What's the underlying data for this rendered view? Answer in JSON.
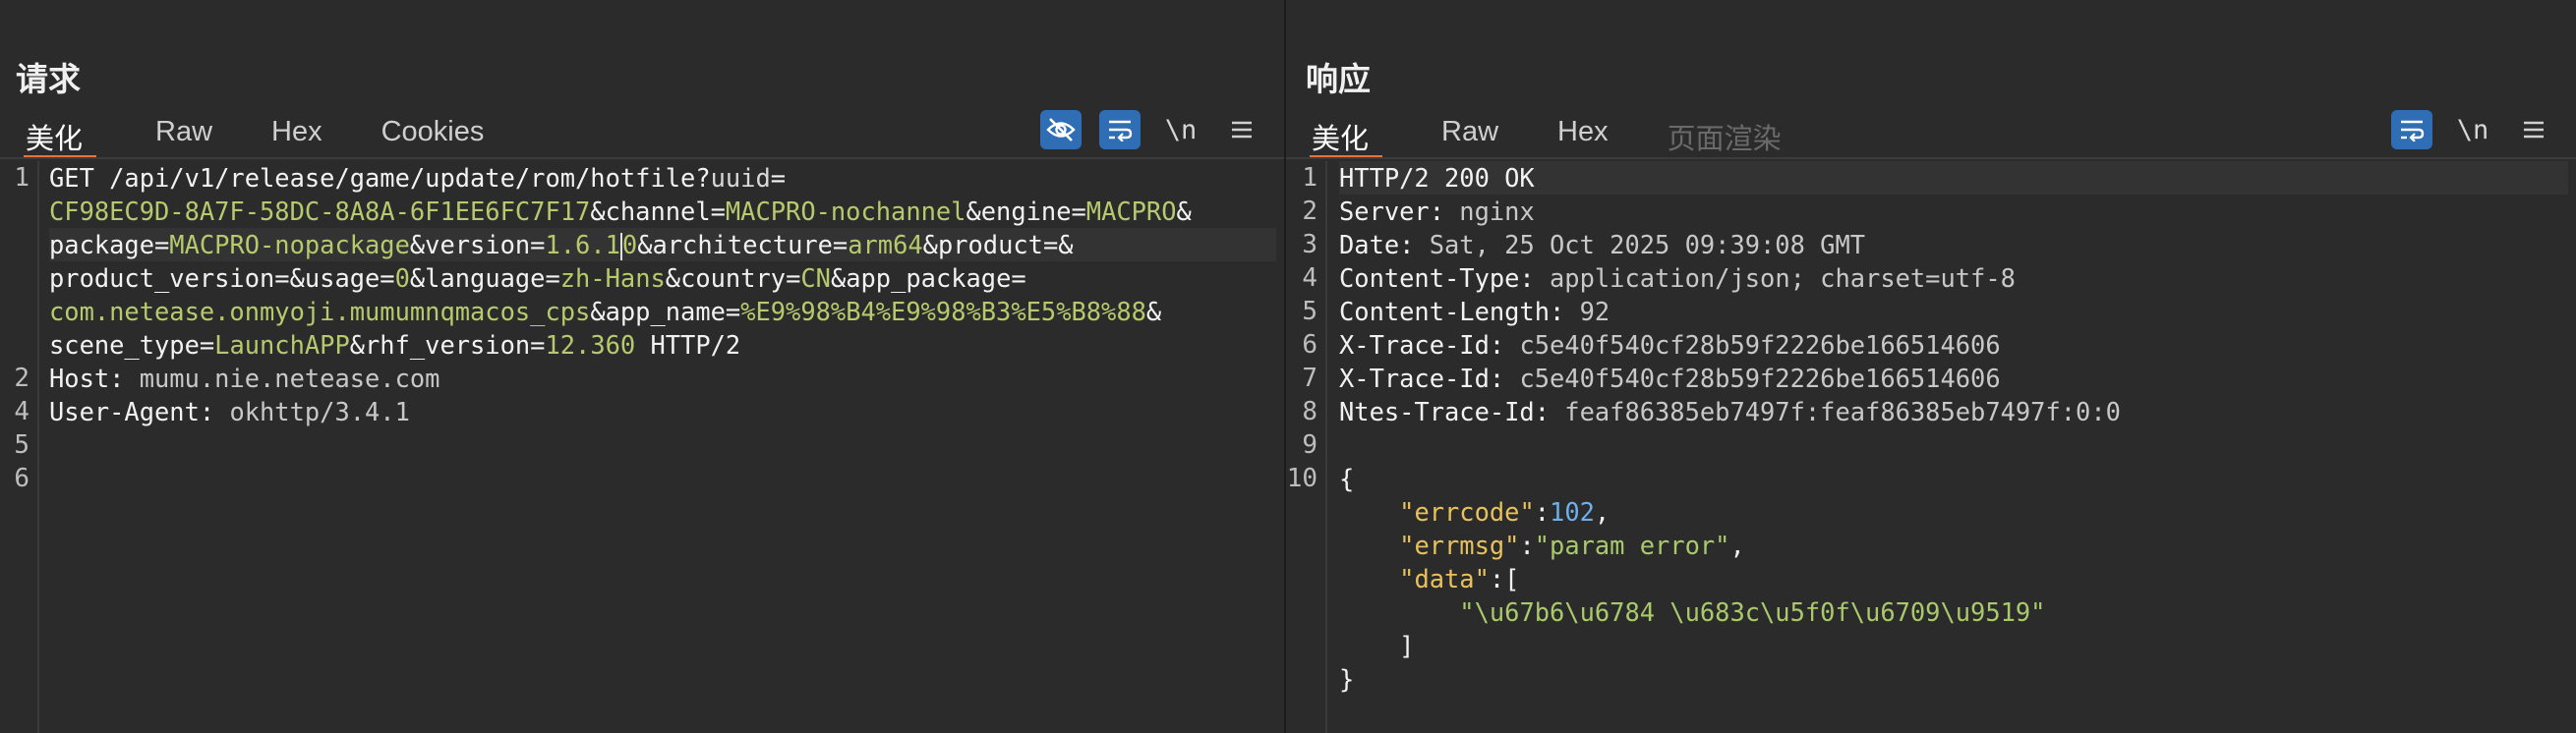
{
  "request": {
    "title": "请求",
    "tabs": [
      "美化",
      "Raw",
      "Hex",
      "Cookies"
    ],
    "toolbar": {
      "newline_label": "\\n"
    },
    "lines": [
      [
        {
          "t": "GET /api/v1/release/game/update/rom/hotfile?",
          "c": "k"
        },
        {
          "t": "uuid",
          "c": "p"
        },
        {
          "t": "=",
          "c": "k"
        }
      ],
      [
        {
          "t": "CF98EC9D-8A7F-58DC-8A8A-6F1EE6FC7F17",
          "c": "v"
        },
        {
          "t": "&channel=",
          "c": "k"
        },
        {
          "t": "MACPRO-nochannel",
          "c": "v"
        },
        {
          "t": "&engine=",
          "c": "k"
        },
        {
          "t": "MACPRO",
          "c": "v"
        },
        {
          "t": "&",
          "c": "k"
        }
      ],
      [
        {
          "t": "package=",
          "c": "k"
        },
        {
          "t": "MACPRO-nopackage",
          "c": "v"
        },
        {
          "t": "&version=",
          "c": "k"
        },
        {
          "t": "1.6.1",
          "c": "v"
        },
        {
          "t": "CURSOR",
          "c": "cursor"
        },
        {
          "t": "0",
          "c": "v"
        },
        {
          "t": "&architecture=",
          "c": "k"
        },
        {
          "t": "arm64",
          "c": "v"
        },
        {
          "t": "&product=&",
          "c": "k"
        }
      ],
      [
        {
          "t": "product_version=&usage=",
          "c": "k"
        },
        {
          "t": "0",
          "c": "v"
        },
        {
          "t": "&language=",
          "c": "k"
        },
        {
          "t": "zh-Hans",
          "c": "v"
        },
        {
          "t": "&country=",
          "c": "k"
        },
        {
          "t": "CN",
          "c": "v"
        },
        {
          "t": "&app_package=",
          "c": "k"
        }
      ],
      [
        {
          "t": "com.netease.onmyoji.mumumnqmacos_cps",
          "c": "v"
        },
        {
          "t": "&app_name=",
          "c": "k"
        },
        {
          "t": "%E9%98%B4%E9%98%B3%E5%B8%88",
          "c": "v"
        },
        {
          "t": "&",
          "c": "k"
        }
      ],
      [
        {
          "t": "scene_type=",
          "c": "k"
        },
        {
          "t": "LaunchAPP",
          "c": "v"
        },
        {
          "t": "&rhf_version=",
          "c": "k"
        },
        {
          "t": "12.360",
          "c": "v"
        },
        {
          "t": " HTTP/2",
          "c": "k"
        }
      ],
      [
        {
          "t": "Host:",
          "c": "k"
        },
        {
          "t": " mumu.nie.netease.com",
          "c": "hv"
        }
      ],
      [
        {
          "t": "User-Agent:",
          "c": "k"
        },
        {
          "t": " okhttp/3.4.1",
          "c": "hv"
        }
      ],
      [],
      []
    ],
    "line_numbers": [
      "1",
      "",
      "",
      "",
      "",
      "",
      "2",
      "4",
      "5",
      "6"
    ]
  },
  "response": {
    "title": "响应",
    "tabs": [
      "美化",
      "Raw",
      "Hex",
      "页面渲染"
    ],
    "toolbar": {
      "newline_label": "\\n"
    },
    "lines": [
      [
        {
          "t": "HTTP/2 200 OK",
          "c": "k"
        }
      ],
      [
        {
          "t": "Server:",
          "c": "k"
        },
        {
          "t": " nginx",
          "c": "hv"
        }
      ],
      [
        {
          "t": "Date:",
          "c": "k"
        },
        {
          "t": " Sat, 25 Oct 2025 09:39:08 GMT",
          "c": "hv"
        }
      ],
      [
        {
          "t": "Content-Type:",
          "c": "k"
        },
        {
          "t": " application/json; charset=utf-8",
          "c": "hv"
        }
      ],
      [
        {
          "t": "Content-Length:",
          "c": "k"
        },
        {
          "t": " 92",
          "c": "hv"
        }
      ],
      [
        {
          "t": "X-Trace-Id:",
          "c": "k"
        },
        {
          "t": " c5e40f540cf28b59f2226be166514606",
          "c": "hv"
        }
      ],
      [
        {
          "t": "X-Trace-Id:",
          "c": "k"
        },
        {
          "t": " c5e40f540cf28b59f2226be166514606",
          "c": "hv"
        }
      ],
      [
        {
          "t": "Ntes-Trace-Id:",
          "c": "k"
        },
        {
          "t": " feaf86385eb7497f:feaf86385eb7497f:0:0",
          "c": "hv"
        }
      ],
      [],
      [
        {
          "t": "{",
          "c": "k"
        }
      ],
      [
        {
          "t": "    ",
          "c": "k"
        },
        {
          "t": "\"errcode\"",
          "c": "str"
        },
        {
          "t": ":",
          "c": "k"
        },
        {
          "t": "102",
          "c": "num"
        },
        {
          "t": ",",
          "c": "k"
        }
      ],
      [
        {
          "t": "    ",
          "c": "k"
        },
        {
          "t": "\"errmsg\"",
          "c": "str"
        },
        {
          "t": ":",
          "c": "k"
        },
        {
          "t": "\"param error\"",
          "c": "sval"
        },
        {
          "t": ",",
          "c": "k"
        }
      ],
      [
        {
          "t": "    ",
          "c": "k"
        },
        {
          "t": "\"data\"",
          "c": "str"
        },
        {
          "t": ":[",
          "c": "k"
        }
      ],
      [
        {
          "t": "        ",
          "c": "k"
        },
        {
          "t": "\"\\u67b6\\u6784 \\u683c\\u5f0f\\u6709\\u9519\"",
          "c": "sval"
        }
      ],
      [
        {
          "t": "    ]",
          "c": "k"
        }
      ],
      [
        {
          "t": "}",
          "c": "k"
        }
      ]
    ],
    "line_numbers": [
      "1",
      "2",
      "3",
      "4",
      "5",
      "6",
      "7",
      "8",
      "9",
      "10",
      "",
      "",
      "",
      "",
      "",
      ""
    ]
  }
}
